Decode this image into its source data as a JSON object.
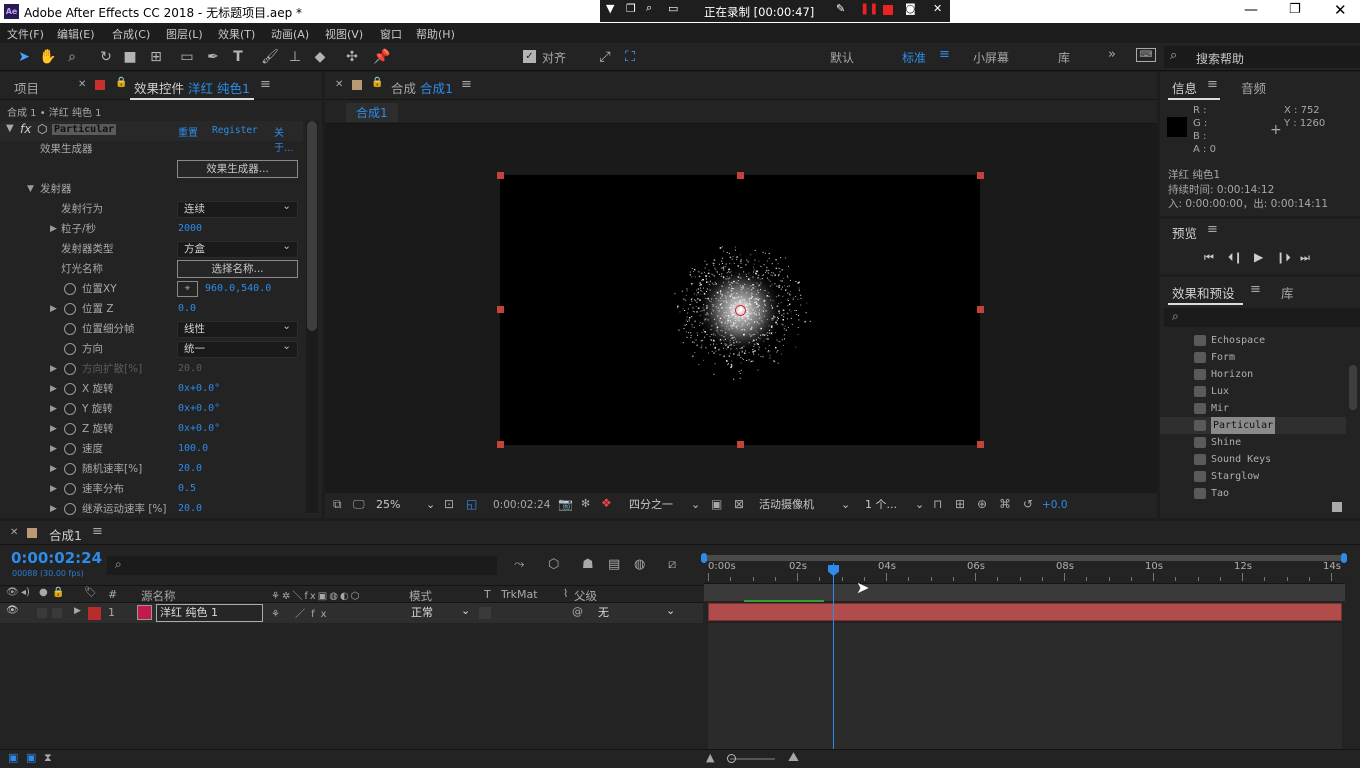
{
  "window": {
    "title": "Adobe After Effects CC 2018 - 无标题项目.aep *",
    "app_icon": "Ae"
  },
  "recorder": {
    "status": "正在录制 [00:00:47]"
  },
  "menu": [
    "文件(F)",
    "编辑(E)",
    "合成(C)",
    "图层(L)",
    "效果(T)",
    "动画(A)",
    "视图(V)",
    "窗口",
    "帮助(H)"
  ],
  "toolbar": {
    "snap_label": "对齐",
    "workspaces": [
      "默认",
      "标准",
      "小屏幕",
      "库"
    ],
    "active_workspace": "标准",
    "search_placeholder": "搜索帮助"
  },
  "left_panel": {
    "tab_project": "项目",
    "tab_effects_prefix": "效果控件",
    "tab_effects_layer": "洋红 纯色1",
    "breadcrumb": "合成 1 • 洋红 纯色 1",
    "effect_name": "Particular",
    "effect_links": [
      "重置",
      "Register",
      "关于..."
    ],
    "rows": [
      {
        "label": "效果生成器",
        "kind": "text"
      },
      {
        "label": "",
        "kind": "button",
        "value": "效果生成器..."
      },
      {
        "label": "发射器",
        "kind": "group"
      },
      {
        "label": "发射行为",
        "kind": "dropdown",
        "value": "连续"
      },
      {
        "label": "粒子/秒",
        "kind": "number",
        "value": "2000"
      },
      {
        "label": "发射器类型",
        "kind": "dropdown",
        "value": "方盒"
      },
      {
        "label": "灯光名称",
        "kind": "button",
        "value": "选择名称..."
      },
      {
        "label": "位置XY",
        "kind": "point",
        "value": "960.0,540.0"
      },
      {
        "label": "位置 Z",
        "kind": "number",
        "value": "0.0"
      },
      {
        "label": "位置细分帧",
        "kind": "dropdown",
        "value": "线性"
      },
      {
        "label": "方向",
        "kind": "dropdown",
        "value": "统一"
      },
      {
        "label": "方向扩散[%]",
        "kind": "disabled",
        "value": "20.0"
      },
      {
        "label": "X 旋转",
        "kind": "number",
        "value": "0x+0.0°"
      },
      {
        "label": "Y 旋转",
        "kind": "number",
        "value": "0x+0.0°"
      },
      {
        "label": "Z 旋转",
        "kind": "number",
        "value": "0x+0.0°"
      },
      {
        "label": "速度",
        "kind": "number",
        "value": "100.0"
      },
      {
        "label": "随机速率[%]",
        "kind": "number",
        "value": "20.0"
      },
      {
        "label": "速率分布",
        "kind": "number",
        "value": "0.5"
      },
      {
        "label": "继承运动速率 [%]",
        "kind": "number",
        "value": "20.0"
      }
    ]
  },
  "comp_panel": {
    "tab_prefix": "合成",
    "tab_name": "合成1",
    "sub_tab": "合成1",
    "bottom": {
      "zoom": "25%",
      "timecode": "0:00:02:24",
      "resolution": "四分之一",
      "camera": "活动摄像机",
      "views": "1 个...",
      "exposure": "+0.0"
    }
  },
  "info_panel": {
    "tab_info": "信息",
    "tab_audio": "音频",
    "rgba": [
      "R :",
      "G :",
      "B :",
      "A : 0"
    ],
    "x": "X : 752",
    "y": "Y : 1260",
    "layer": "洋红 纯色1",
    "duration": "持续时间: 0:00:14:12",
    "inout": "入: 0:00:00:00，出: 0:00:14:11"
  },
  "preview_panel": {
    "title": "预览"
  },
  "effects_panel": {
    "tab": "效果和预设",
    "tab_lib": "库",
    "items": [
      "Echospace",
      "Form",
      "Horizon",
      "Lux",
      "Mir",
      "Particular",
      "Shine",
      "Sound Keys",
      "Starglow",
      "Tao"
    ],
    "selected": "Particular"
  },
  "timeline": {
    "tab": "合成1",
    "timecode": "0:00:02:24",
    "fps": "00088 (30.00 fps)",
    "columns": {
      "num": "#",
      "source": "源名称",
      "mode": "模式",
      "t": "T",
      "trkmat": "TrkMat",
      "parent": "父级"
    },
    "ruler": [
      "0:00s",
      "02s",
      "04s",
      "06s",
      "08s",
      "10s",
      "12s",
      "14s"
    ],
    "playhead_seconds": 2.8,
    "duration_seconds": 14.4,
    "layer": {
      "index": "1",
      "name": "洋红 纯色 1",
      "mode": "正常",
      "parent": "无",
      "color": "#c21a4a"
    }
  }
}
